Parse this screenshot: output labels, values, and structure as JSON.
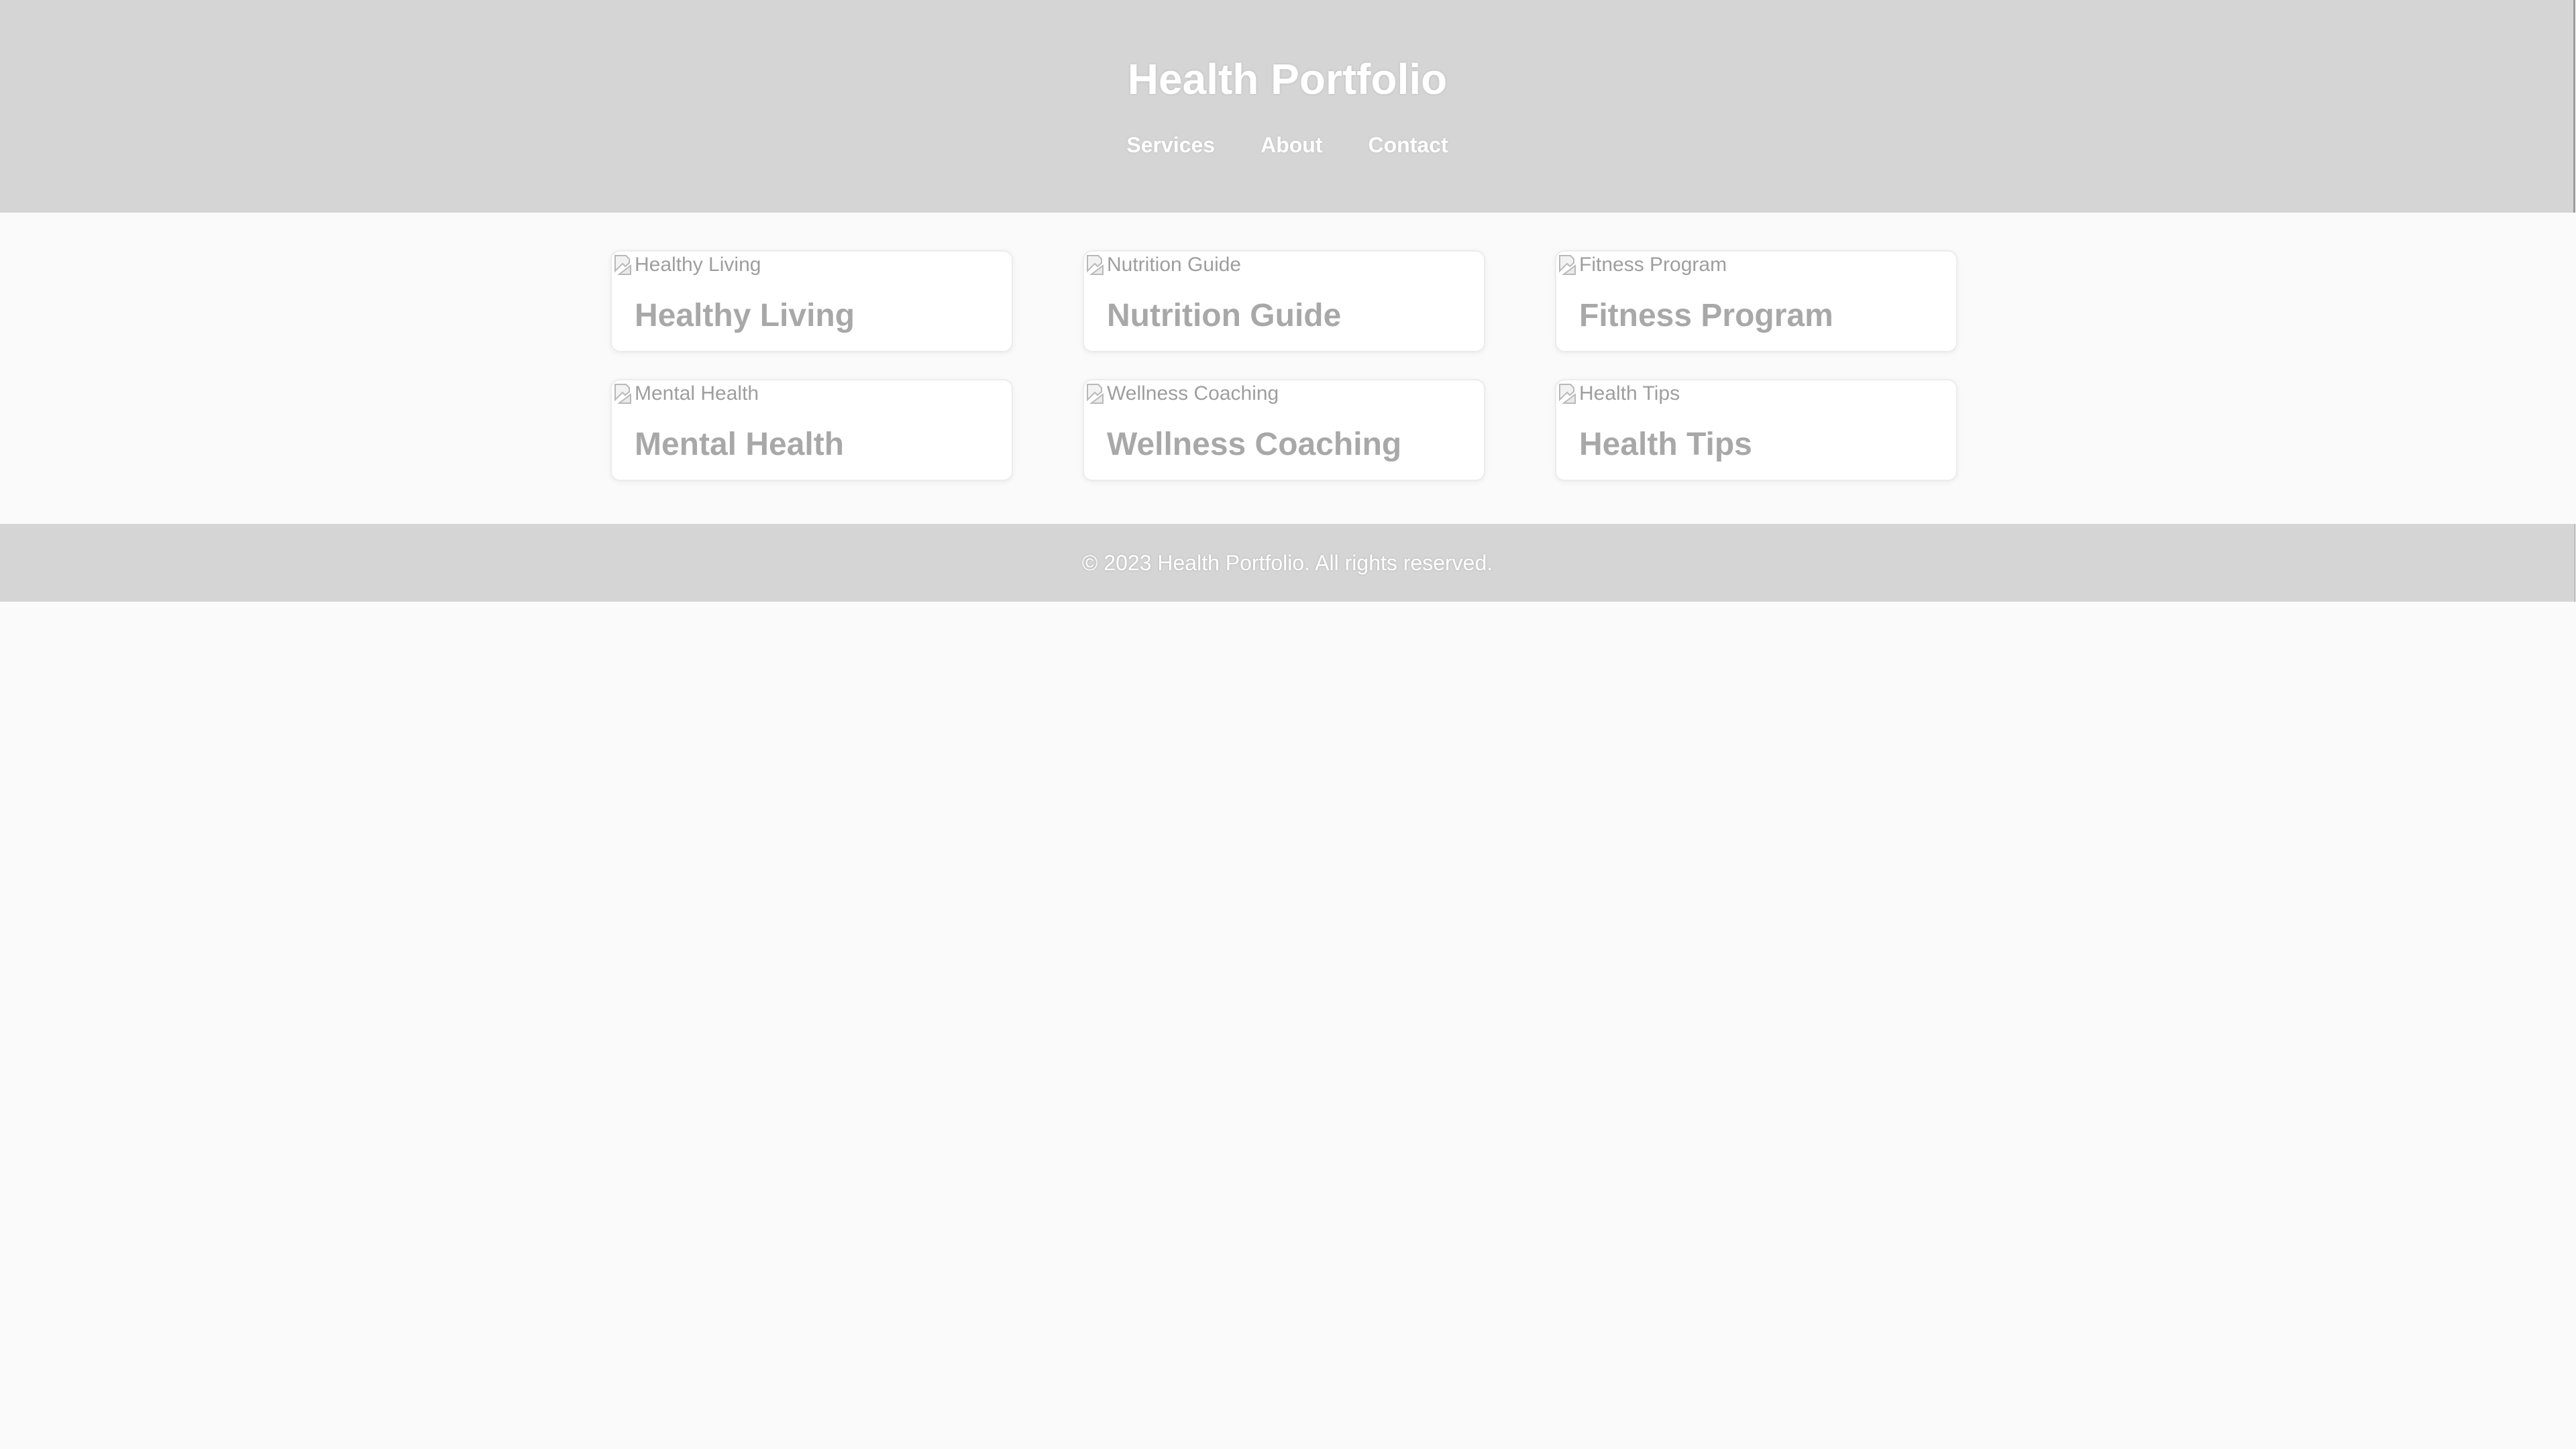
{
  "header": {
    "title": "Health Portfolio",
    "nav": [
      "Services",
      "About",
      "Contact"
    ]
  },
  "cards": [
    {
      "image_alt": "Healthy Living",
      "title": "Healthy Living"
    },
    {
      "image_alt": "Nutrition Guide",
      "title": "Nutrition Guide"
    },
    {
      "image_alt": "Fitness Program",
      "title": "Fitness Program"
    },
    {
      "image_alt": "Mental Health",
      "title": "Mental Health"
    },
    {
      "image_alt": "Wellness Coaching",
      "title": "Wellness Coaching"
    },
    {
      "image_alt": "Health Tips",
      "title": "Health Tips"
    }
  ],
  "footer": {
    "text": "© 2023 Health Portfolio. All rights reserved."
  },
  "icons": {
    "card_image": "broken-image-icon"
  },
  "colors": {
    "header_bg": "#d5d5d5",
    "page_bg": "#fafafa",
    "card_title": "#a8a8a8",
    "header_text": "#ffffff"
  }
}
